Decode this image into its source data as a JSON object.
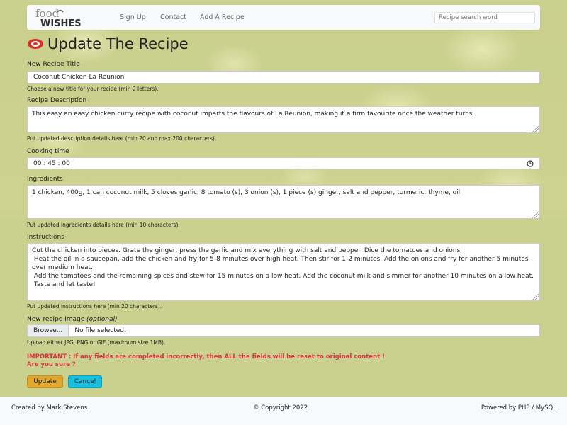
{
  "nav": {
    "logo_text_top": "food",
    "logo_text_bottom": "WISHES",
    "links": [
      "Sign Up",
      "Contact",
      "Add A Recipe"
    ],
    "search_placeholder": "Recipe search word"
  },
  "page": {
    "title": "Update The Recipe",
    "title_icon": "recipe-logo-icon"
  },
  "form": {
    "title_label": "New Recipe Title",
    "title_value": "Coconut Chicken La Reunion",
    "title_help": "Choose a new title for your recipe (min 2 letters).",
    "description_label": "Recipe Description",
    "description_value": "This easy an easy chicken curry recipe with coconut imparts the flavours of La Reunion, making it a firm favourite once the weather turns.",
    "description_help": "Put updated description details here (min 20 and max 200 characters).",
    "cooking_label": "Cooking time",
    "cooking_value": "00 : 45 : 00",
    "ingredients_label": "Ingredients",
    "ingredients_value": "1 chicken, 400g, 1 can coconut milk, 5 cloves garlic, 8 tomato (s), 3 onion (s), 1 piece (s) ginger, salt and pepper, turmeric, thyme, oil",
    "ingredients_help": "Put updated ingredients details here (min 10 characters).",
    "instructions_label": "Instructions",
    "instructions_value": "Cut the chicken into pieces. Grate the ginger, press the garlic and mix everything with salt and pepper. Dice the tomatoes and onions.\n Heat the oil in a saucepan, add the chicken and fry for 5-8 minutes over high heat. Then stir for 1-2 minutes. Add the onions and fry for another 5 minutes over medium heat.\n Add the tomatoes and the remaining spices and stew for 15 minutes on a low heat. Add the coconut milk and simmer for another 10 minutes on a low heat.\n Taste and let taste!",
    "instructions_help": "Put updated instructions here (min 20 characters).",
    "image_label": "New recipe Image",
    "image_optional": "(optional)",
    "browse_label": "Browse...",
    "file_status": "No file selected.",
    "image_help": "Upload either JPG, PNG or GIF (maximum size 1MB).",
    "warning_line1": "IMPORTANT : If any fields are completed incorrectly, then ALL the fields will be reset to original content !",
    "warning_line2": "Are you sure ?",
    "update_label": "Update",
    "cancel_label": "Cancel"
  },
  "footer": {
    "left": "Created by Mark Stevens",
    "center": "© Copyright 2022",
    "right": "Powered by PHP / MySQL"
  },
  "colors": {
    "update_button": "#e0a830",
    "cancel_button": "#17c0e0",
    "warning_text": "#dc3545"
  }
}
